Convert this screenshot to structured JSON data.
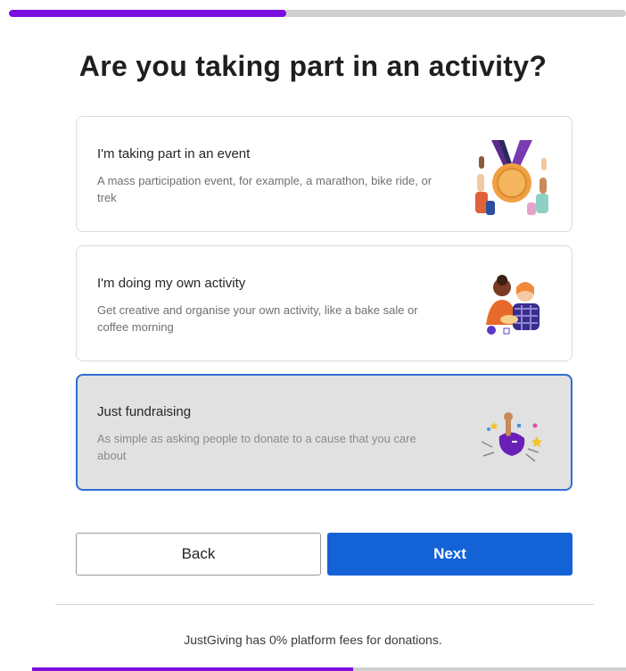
{
  "progress": {
    "value_percent": 45,
    "color": "#7a0fde"
  },
  "title": "Are you taking part in an activity?",
  "options": [
    {
      "title": "I'm taking part in an event",
      "description": "A mass participation event, for example, a marathon, bike ride, or trek",
      "icon": "medal-illustration",
      "selected": false
    },
    {
      "title": "I'm doing my own activity",
      "description": "Get creative and organise your own activity, like a bake sale or coffee morning",
      "icon": "people-activity-illustration",
      "selected": false
    },
    {
      "title": "Just fundraising",
      "description": "As simple as asking people to donate to a cause that you care about",
      "icon": "fundraising-celebration-illustration",
      "selected": true
    }
  ],
  "buttons": {
    "back": "Back",
    "next": "Next"
  },
  "footer": {
    "note": "JustGiving has 0% platform fees for donations."
  },
  "colors": {
    "accent_blue": "#1463d6",
    "selected_border": "#2f6fd1",
    "brand_purple": "#7a0fde"
  }
}
